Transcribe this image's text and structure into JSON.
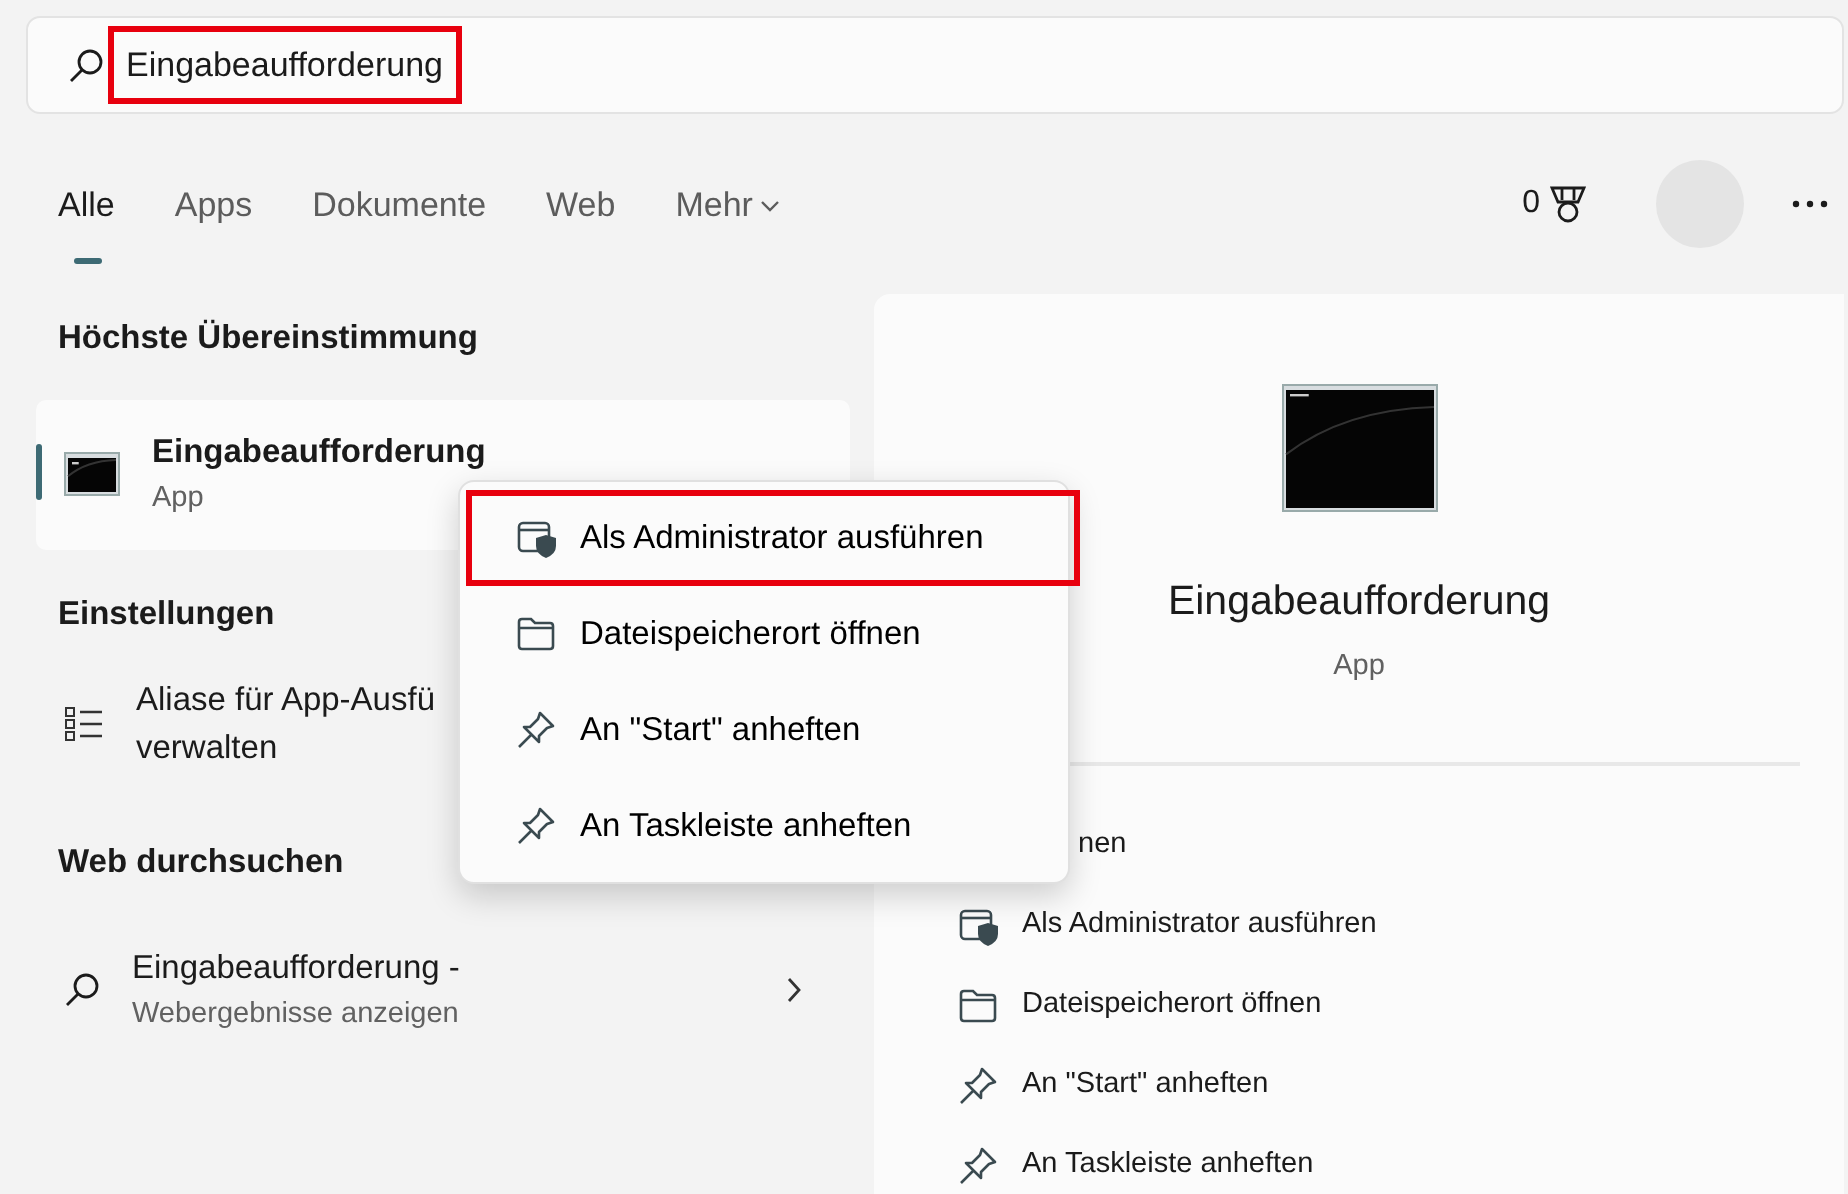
{
  "search": {
    "value": "Eingabeaufforderung",
    "highlighted": true
  },
  "tabs": [
    {
      "label": "Alle",
      "selected": true,
      "kind": "tab"
    },
    {
      "label": "Apps",
      "selected": false,
      "kind": "tab"
    },
    {
      "label": "Dokumente",
      "selected": false,
      "kind": "tab"
    },
    {
      "label": "Web",
      "selected": false,
      "kind": "tab"
    },
    {
      "label": "Mehr",
      "selected": false,
      "kind": "dropdown"
    }
  ],
  "rewards": {
    "points": "0"
  },
  "best_match": {
    "heading": "Höchste Übereinstimmung",
    "item": {
      "title": "Eingabeaufforderung",
      "subtitle": "App",
      "selected": true
    }
  },
  "settings": {
    "heading": "Einstellungen",
    "items": [
      {
        "line_1": "Aliase für App-Ausfü",
        "line_2": "verwalten"
      }
    ]
  },
  "web_search": {
    "heading": "Web durchsuchen",
    "items": [
      {
        "title": "Eingabeaufforderung -",
        "subtitle": "Webergebnisse anzeigen"
      }
    ]
  },
  "preview": {
    "title": "Eingabeaufforderung",
    "subtitle": "App",
    "actions": [
      {
        "label": "nen"
      },
      {
        "label": "Als Administrator ausführen",
        "kind": "admin"
      },
      {
        "label": "Dateispeicherort öffnen",
        "kind": "location"
      },
      {
        "label": "An \"Start\" anheften",
        "kind": "pin"
      },
      {
        "label": "An Taskleiste anheften",
        "kind": "pin"
      }
    ]
  },
  "context_menu": {
    "items": [
      {
        "label": "Als Administrator ausführen",
        "kind": "admin",
        "highlighted": true
      },
      {
        "label": "Dateispeicherort öffnen",
        "kind": "location",
        "highlighted": false
      },
      {
        "label": "An \"Start\" anheften",
        "kind": "pin",
        "highlighted": false
      },
      {
        "label": "An Taskleiste anheften",
        "kind": "pin",
        "highlighted": false
      }
    ]
  }
}
